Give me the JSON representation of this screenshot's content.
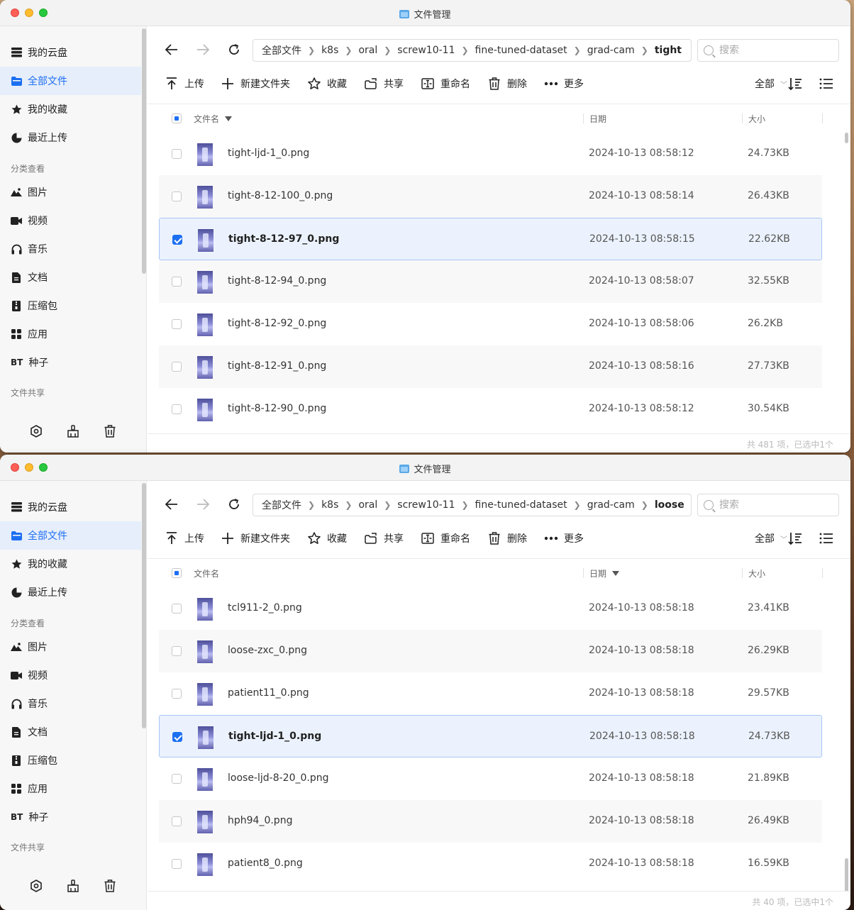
{
  "windows": [
    {
      "title": "文件管理",
      "sidebar": {
        "items": [
          {
            "label": "我的云盘",
            "icon": "drive-icon"
          },
          {
            "label": "全部文件",
            "icon": "folder-icon"
          },
          {
            "label": "我的收藏",
            "icon": "star-icon"
          },
          {
            "label": "最近上传",
            "icon": "clock-icon"
          }
        ],
        "section_category": "分类查看",
        "categories": [
          {
            "label": "图片",
            "icon": "image-icon"
          },
          {
            "label": "视频",
            "icon": "video-icon"
          },
          {
            "label": "音乐",
            "icon": "headphones-icon"
          },
          {
            "label": "文档",
            "icon": "document-icon"
          },
          {
            "label": "压缩包",
            "icon": "archive-icon"
          },
          {
            "label": "应用",
            "icon": "apps-icon"
          },
          {
            "label": "种子",
            "prefix": "BT"
          }
        ],
        "section_share": "文件共享"
      },
      "breadcrumb": [
        "全部文件",
        "k8s",
        "oral",
        "screw10-11",
        "fine-tuned-dataset",
        "grad-cam",
        "tight"
      ],
      "search_placeholder": "搜索",
      "toolbar": {
        "upload": "上传",
        "new_folder": "新建文件夹",
        "favorite": "收藏",
        "share": "共享",
        "rename": "重命名",
        "delete": "删除",
        "more": "更多",
        "filter": "全部"
      },
      "columns": {
        "name": "文件名",
        "date": "日期",
        "size": "大小",
        "sorted_by": "name"
      },
      "files": [
        {
          "name": "tight-ljd-1_0.png",
          "date": "2024-10-13 08:58:12",
          "size": "24.73KB",
          "selected": false
        },
        {
          "name": "tight-8-12-100_0.png",
          "date": "2024-10-13 08:58:14",
          "size": "26.43KB",
          "selected": false
        },
        {
          "name": "tight-8-12-97_0.png",
          "date": "2024-10-13 08:58:15",
          "size": "22.62KB",
          "selected": true
        },
        {
          "name": "tight-8-12-94_0.png",
          "date": "2024-10-13 08:58:07",
          "size": "32.55KB",
          "selected": false
        },
        {
          "name": "tight-8-12-92_0.png",
          "date": "2024-10-13 08:58:06",
          "size": "26.2KB",
          "selected": false
        },
        {
          "name": "tight-8-12-91_0.png",
          "date": "2024-10-13 08:58:16",
          "size": "27.73KB",
          "selected": false
        },
        {
          "name": "tight-8-12-90_0.png",
          "date": "2024-10-13 08:58:12",
          "size": "30.54KB",
          "selected": false
        }
      ],
      "status": "共 481 项，已选中1个"
    },
    {
      "title": "文件管理",
      "sidebar": {
        "items": [
          {
            "label": "我的云盘",
            "icon": "drive-icon"
          },
          {
            "label": "全部文件",
            "icon": "folder-icon"
          },
          {
            "label": "我的收藏",
            "icon": "star-icon"
          },
          {
            "label": "最近上传",
            "icon": "clock-icon"
          }
        ],
        "section_category": "分类查看",
        "categories": [
          {
            "label": "图片",
            "icon": "image-icon"
          },
          {
            "label": "视频",
            "icon": "video-icon"
          },
          {
            "label": "音乐",
            "icon": "headphones-icon"
          },
          {
            "label": "文档",
            "icon": "document-icon"
          },
          {
            "label": "压缩包",
            "icon": "archive-icon"
          },
          {
            "label": "应用",
            "icon": "apps-icon"
          },
          {
            "label": "种子",
            "prefix": "BT"
          }
        ],
        "section_share": "文件共享"
      },
      "breadcrumb": [
        "全部文件",
        "k8s",
        "oral",
        "screw10-11",
        "fine-tuned-dataset",
        "grad-cam",
        "loose"
      ],
      "search_placeholder": "搜索",
      "toolbar": {
        "upload": "上传",
        "new_folder": "新建文件夹",
        "favorite": "收藏",
        "share": "共享",
        "rename": "重命名",
        "delete": "删除",
        "more": "更多",
        "filter": "全部"
      },
      "columns": {
        "name": "文件名",
        "date": "日期",
        "size": "大小",
        "sorted_by": "date"
      },
      "files": [
        {
          "name": "tcl911-2_0.png",
          "date": "2024-10-13 08:58:18",
          "size": "23.41KB",
          "selected": false
        },
        {
          "name": "loose-zxc_0.png",
          "date": "2024-10-13 08:58:18",
          "size": "26.29KB",
          "selected": false
        },
        {
          "name": "patient11_0.png",
          "date": "2024-10-13 08:58:18",
          "size": "29.57KB",
          "selected": false
        },
        {
          "name": "tight-ljd-1_0.png",
          "date": "2024-10-13 08:58:18",
          "size": "24.73KB",
          "selected": true
        },
        {
          "name": "loose-ljd-8-20_0.png",
          "date": "2024-10-13 08:58:18",
          "size": "21.89KB",
          "selected": false
        },
        {
          "name": "hph94_0.png",
          "date": "2024-10-13 08:58:18",
          "size": "26.49KB",
          "selected": false
        },
        {
          "name": "patient8_0.png",
          "date": "2024-10-13 08:58:18",
          "size": "16.59KB",
          "selected": false
        }
      ],
      "status": "共 40 项，已选中1个"
    }
  ],
  "colors": {
    "accent": "#1d6ff2",
    "selected_row": "#ebf2fd",
    "sidebar_bg": "#f7f7f7"
  }
}
